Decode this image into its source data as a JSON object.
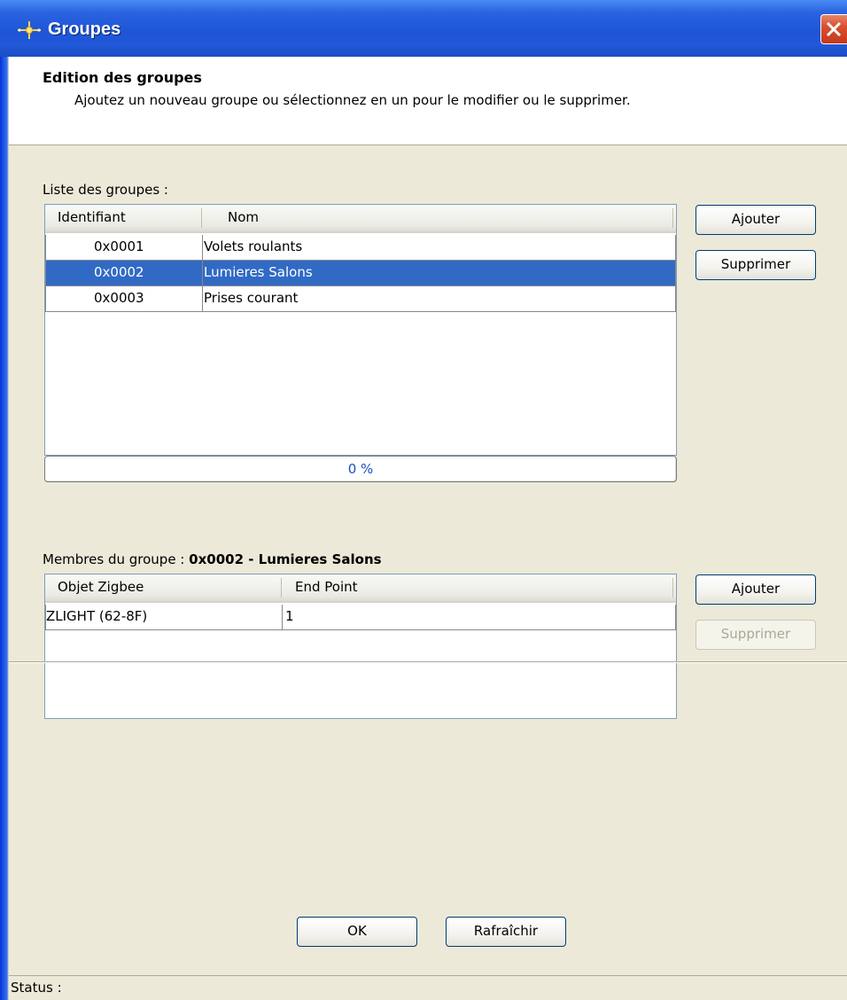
{
  "window": {
    "title": "Groupes",
    "icon": "sparkle-icon",
    "close_icon": "close-x-icon"
  },
  "header": {
    "title": "Edition des groupes",
    "subtitle": "Ajoutez un nouveau groupe ou sélectionnez en un pour le modifier ou le supprimer."
  },
  "groups": {
    "label": "Liste des groupes :",
    "columns": [
      "Identifiant",
      "Nom"
    ],
    "rows": [
      {
        "id": "0x0001",
        "name": "Volets roulants",
        "selected": false
      },
      {
        "id": "0x0002",
        "name": "Lumieres Salons",
        "selected": true
      },
      {
        "id": "0x0003",
        "name": "Prises courant",
        "selected": false
      }
    ],
    "add_label": "Ajouter",
    "delete_label": "Supprimer",
    "progress_text": "0 %",
    "progress_value": 0
  },
  "members": {
    "label_prefix": "Membres du groupe : ",
    "label_group": "0x0002 - Lumieres Salons",
    "columns": [
      "Objet Zigbee",
      "End Point"
    ],
    "rows": [
      {
        "object": "ZLIGHT (62-8F)",
        "endpoint": "1"
      }
    ],
    "add_label": "Ajouter",
    "delete_label": "Supprimer",
    "delete_enabled": false
  },
  "footer": {
    "ok_label": "OK",
    "refresh_label": "Rafraîchir"
  },
  "status": {
    "text": "Status :"
  },
  "colors": {
    "selection": "#316ac5",
    "titlebar": "#2158d8",
    "dialog_bg": "#ece9d8",
    "close_button": "#d9502f"
  }
}
